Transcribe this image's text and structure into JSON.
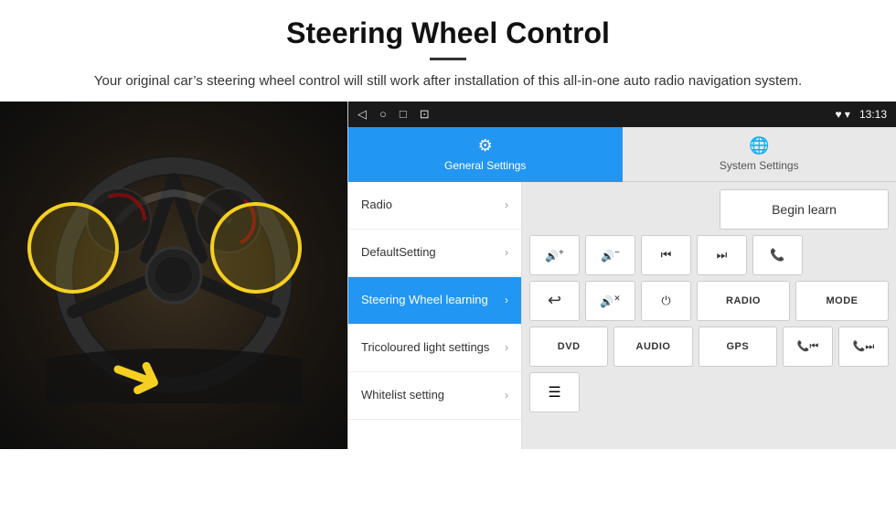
{
  "header": {
    "title": "Steering Wheel Control",
    "subtitle": "Your original car’s steering wheel control will still work after installation of this all-in-one auto radio navigation system."
  },
  "statusBar": {
    "icons": [
      "◁",
      "○",
      "□",
      "⊡"
    ],
    "rightIcons": "♥ ▾",
    "time": "13:13"
  },
  "tabs": [
    {
      "id": "general",
      "label": "General Settings",
      "icon": "⚙",
      "active": true
    },
    {
      "id": "system",
      "label": "System Settings",
      "icon": "🌐",
      "active": false
    }
  ],
  "menuItems": [
    {
      "id": "radio",
      "label": "Radio",
      "active": false
    },
    {
      "id": "defaultsetting",
      "label": "DefaultSetting",
      "active": false
    },
    {
      "id": "steering",
      "label": "Steering Wheel learning",
      "active": true
    },
    {
      "id": "tricoloured",
      "label": "Tricoloured light settings",
      "active": false
    },
    {
      "id": "whitelist",
      "label": "Whitelist setting",
      "active": false
    }
  ],
  "controls": {
    "beginLearnLabel": "Begin learn",
    "row1": [
      {
        "type": "icon",
        "content": "🔊+",
        "label": "volume-up"
      },
      {
        "type": "icon",
        "content": "🔊-",
        "label": "volume-down"
      },
      {
        "type": "icon",
        "content": "⏮",
        "label": "prev-track"
      },
      {
        "type": "icon",
        "content": "⏭",
        "label": "next-track"
      },
      {
        "type": "icon",
        "content": "📞",
        "label": "phone"
      }
    ],
    "row2": [
      {
        "type": "icon",
        "content": "↩",
        "label": "back"
      },
      {
        "type": "icon",
        "content": "🔇",
        "label": "mute"
      },
      {
        "type": "icon",
        "content": "⏻",
        "label": "power"
      },
      {
        "type": "text",
        "content": "RADIO",
        "label": "radio"
      },
      {
        "type": "text",
        "content": "MODE",
        "label": "mode"
      }
    ],
    "row3": [
      {
        "type": "text",
        "content": "DVD",
        "label": "dvd"
      },
      {
        "type": "text",
        "content": "AUDIO",
        "label": "audio"
      },
      {
        "type": "text",
        "content": "GPS",
        "label": "gps"
      },
      {
        "type": "icon",
        "content": "📞⏮",
        "label": "phone-prev"
      },
      {
        "type": "icon",
        "content": "📞⏭",
        "label": "phone-next"
      }
    ],
    "bottomIcon": {
      "content": "☰",
      "label": "menu-icon"
    }
  }
}
